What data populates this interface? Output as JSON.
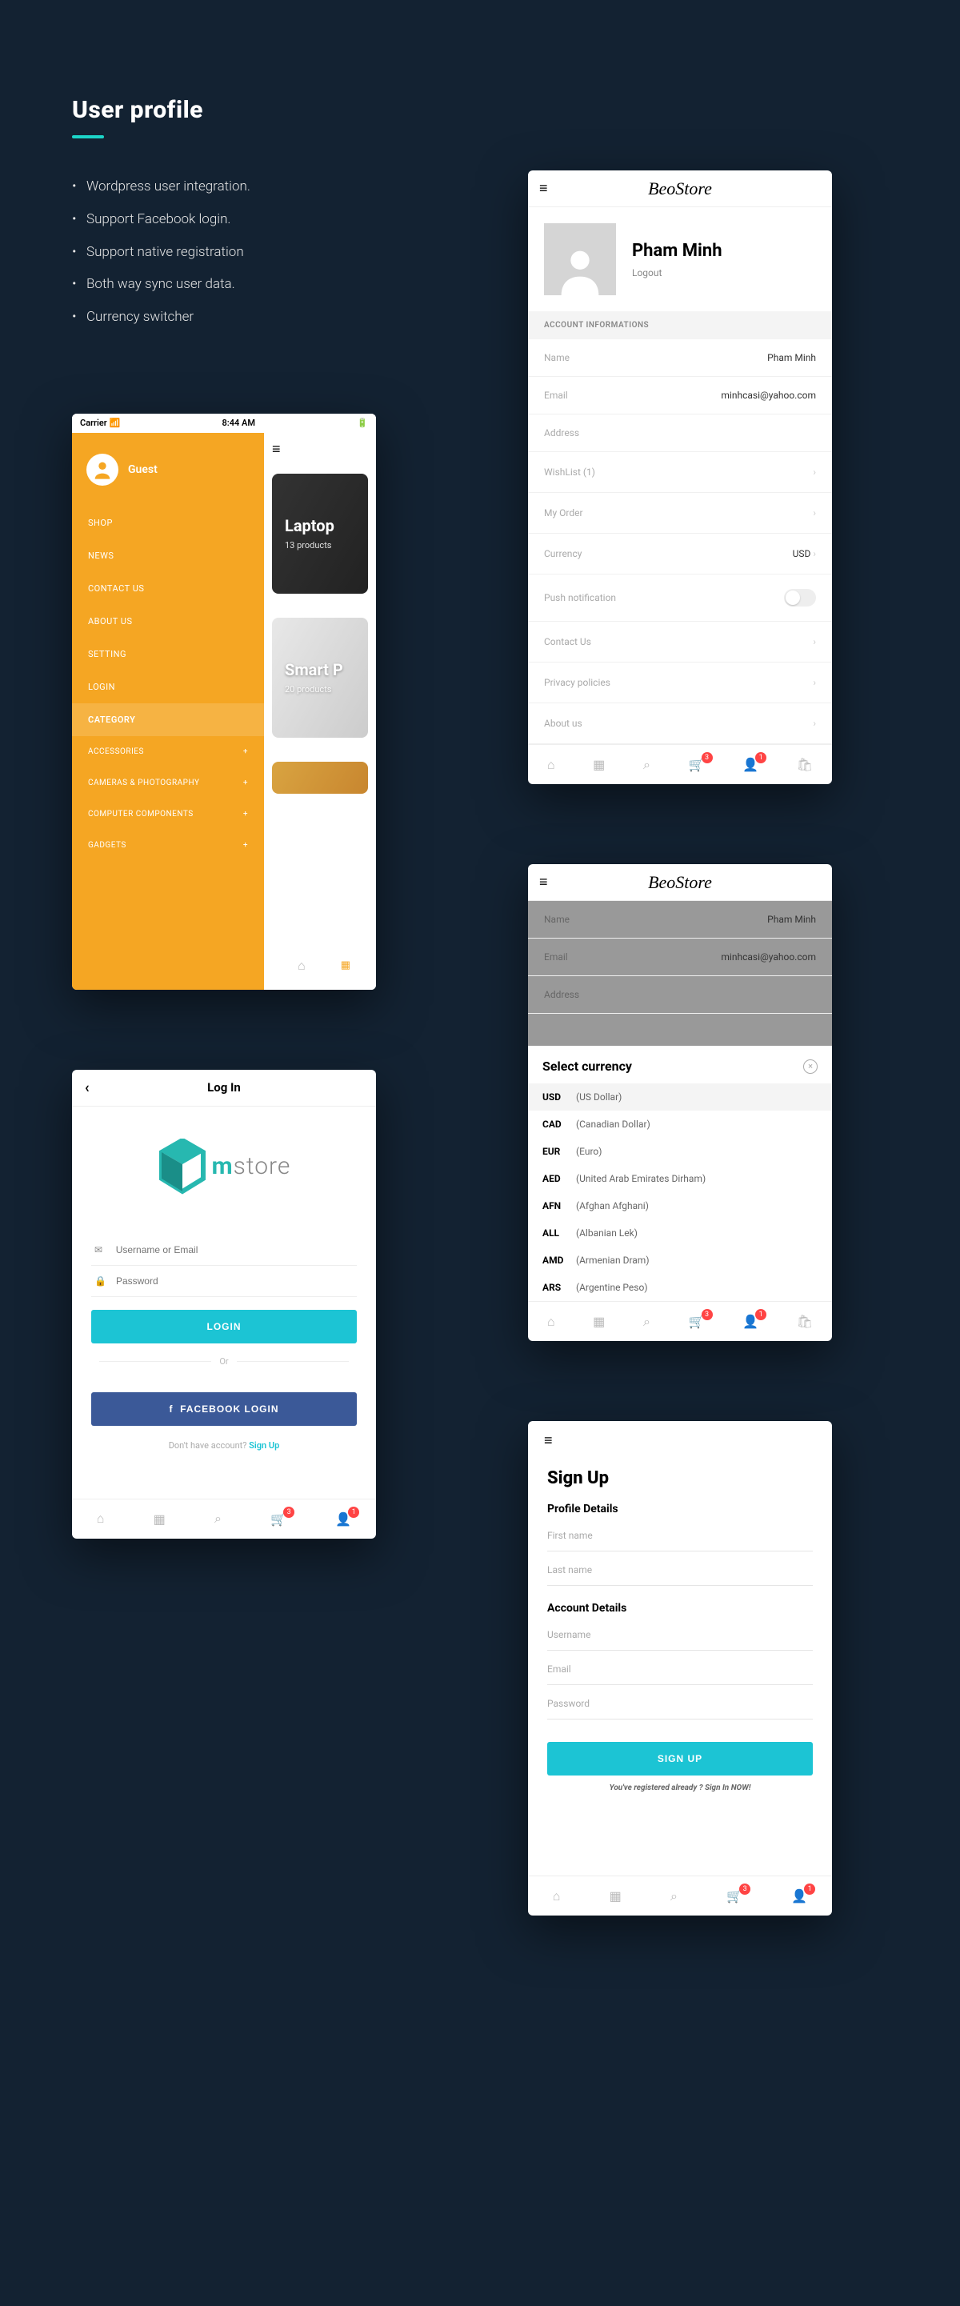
{
  "header": {
    "title": "User profile"
  },
  "bullets": [
    "Wordpress user integration.",
    "Support Facebook login.",
    "Support native registration",
    "Both way sync user data.",
    "Currency switcher"
  ],
  "beo": {
    "appName": "BeoStore",
    "userName": "Pham Minh",
    "logout": "Logout",
    "sectionTitle": "ACCOUNT INFORMATIONS",
    "info": {
      "nameLabel": "Name",
      "nameVal": "Pham Minh",
      "emailLabel": "Email",
      "emailVal": "minhcasi@yahoo.com",
      "addressLabel": "Address"
    },
    "menu": {
      "wishlist": "WishList (1)",
      "order": "My Order",
      "currency": "Currency",
      "currencyVal": "USD",
      "push": "Push notification",
      "contact": "Contact Us",
      "privacy": "Privacy policies",
      "about": "About us"
    },
    "badges": {
      "cart": "3",
      "user": "1"
    }
  },
  "orange": {
    "statusLeft": "Carrier ",
    "statusTime": "8:44 AM",
    "guest": "Guest",
    "main": [
      "SHOP",
      "NEWS",
      "CONTACT US",
      "ABOUT US",
      "SETTING",
      "LOGIN"
    ],
    "category": "CATEGORY",
    "subs": [
      "ACCESSORIES",
      "CAMERAS & PHOTOGRAPHY",
      "COMPUTER COMPONENTS",
      "GADGETS"
    ],
    "cards": [
      {
        "title": "Laptop",
        "sub": "13 products"
      },
      {
        "title": "Smart P",
        "sub": "20 products"
      }
    ]
  },
  "currencySheet": {
    "title": "Select currency",
    "items": [
      {
        "code": "USD",
        "name": "(US Dollar)"
      },
      {
        "code": "CAD",
        "name": "(Canadian Dollar)"
      },
      {
        "code": "EUR",
        "name": "(Euro)"
      },
      {
        "code": "AED",
        "name": "(United Arab Emirates Dirham)"
      },
      {
        "code": "AFN",
        "name": "(Afghan Afghani)"
      },
      {
        "code": "ALL",
        "name": "(Albanian Lek)"
      },
      {
        "code": "AMD",
        "name": "(Armenian Dram)"
      },
      {
        "code": "ARS",
        "name": "(Argentine Peso)"
      }
    ]
  },
  "login": {
    "title": "Log In",
    "logo1": "m",
    "logo2": "store",
    "userPh": "Username or Email",
    "passPh": "Password",
    "loginBtn": "LOGIN",
    "or": "Or",
    "fbBtn": "FACEBOOK LOGIN",
    "noAccount": "Don't have account? ",
    "signup": "Sign Up",
    "badges": {
      "cart": "3",
      "user": "1"
    }
  },
  "signup": {
    "title": "Sign Up",
    "s1": "Profile Details",
    "fn": "First name",
    "ln": "Last name",
    "s2": "Account Details",
    "un": "Username",
    "em": "Email",
    "pw": "Password",
    "btn": "SIGN UP",
    "note": "You've registered already ? Sign In NOW!",
    "badges": {
      "cart": "3",
      "user": "1"
    }
  }
}
